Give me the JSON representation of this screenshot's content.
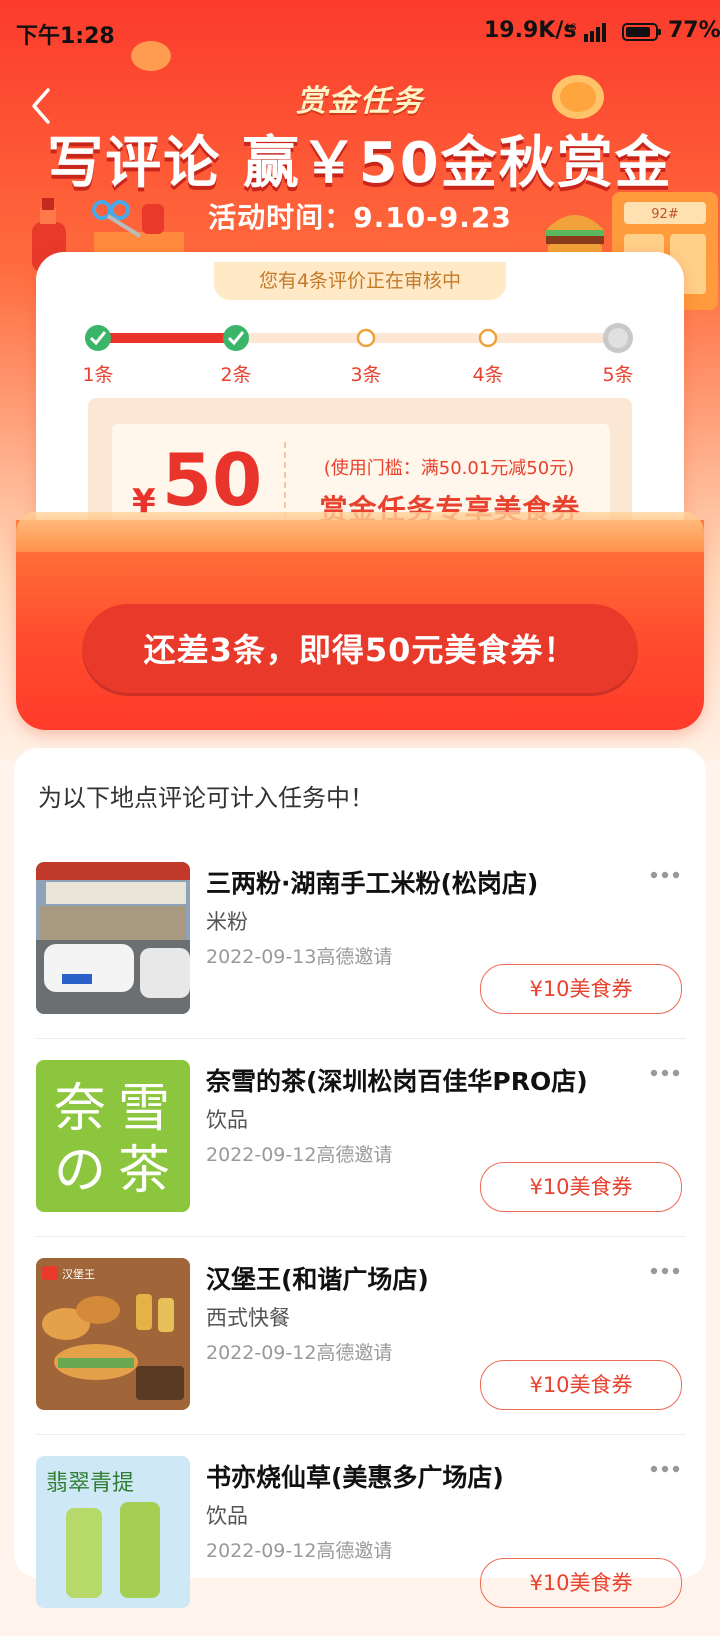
{
  "status_bar": {
    "time": "下午1:28",
    "speed": "19.9K/s",
    "network": "4G",
    "battery": "77%"
  },
  "header": {
    "tag": "赏金任务",
    "headline": "写评论 赢￥50金秋赏金",
    "time_range": "活动时间：9.10-9.23",
    "vending_label": "92#"
  },
  "progress": {
    "review_status": "您有4条评价正在审核中",
    "completed_steps": 2,
    "steps": [
      {
        "label": "1条",
        "state": "done"
      },
      {
        "label": "2条",
        "state": "done"
      },
      {
        "label": "3条",
        "state": "pending"
      },
      {
        "label": "4条",
        "state": "pending"
      },
      {
        "label": "5条",
        "state": "final"
      }
    ]
  },
  "coupon": {
    "currency": "¥",
    "amount": "50",
    "threshold": "(使用门槛：满50.01元减50元)",
    "name": "赏金任务专享美食券"
  },
  "cta_label": "还差3条，即得50元美食券！",
  "list": {
    "title": "为以下地点评论可计入任务中！",
    "shops": [
      {
        "name": "三两粉·湖南手工米粉(松岗店)",
        "category": "米粉",
        "date": "2022-09-13高德邀请",
        "coupon": "¥10美食券",
        "thumb": "street"
      },
      {
        "name": "奈雪的茶(深圳松岗百佳华PRO店)",
        "category": "饮品",
        "date": "2022-09-12高德邀请",
        "coupon": "¥10美食券",
        "thumb": "naixue",
        "thumb_text": [
          "奈",
          "雪",
          "の",
          "茶"
        ]
      },
      {
        "name": "汉堡王(和谐广场店)",
        "category": "西式快餐",
        "date": "2022-09-12高德邀请",
        "coupon": "¥10美食券",
        "thumb": "burger",
        "thumb_text": "汉堡王"
      },
      {
        "name": "书亦烧仙草(美惠多广场店)",
        "category": "饮品",
        "date": "2022-09-12高德邀请",
        "coupon": "¥10美食券",
        "thumb": "drink",
        "thumb_text": "翡翠青提"
      }
    ]
  },
  "colors": {
    "brand_red": "#e8392b",
    "coupon_text": "#e8422e",
    "naixue_green": "#8cc63f",
    "step_done": "#3bb56a",
    "step_pending": "#f0a23a"
  }
}
